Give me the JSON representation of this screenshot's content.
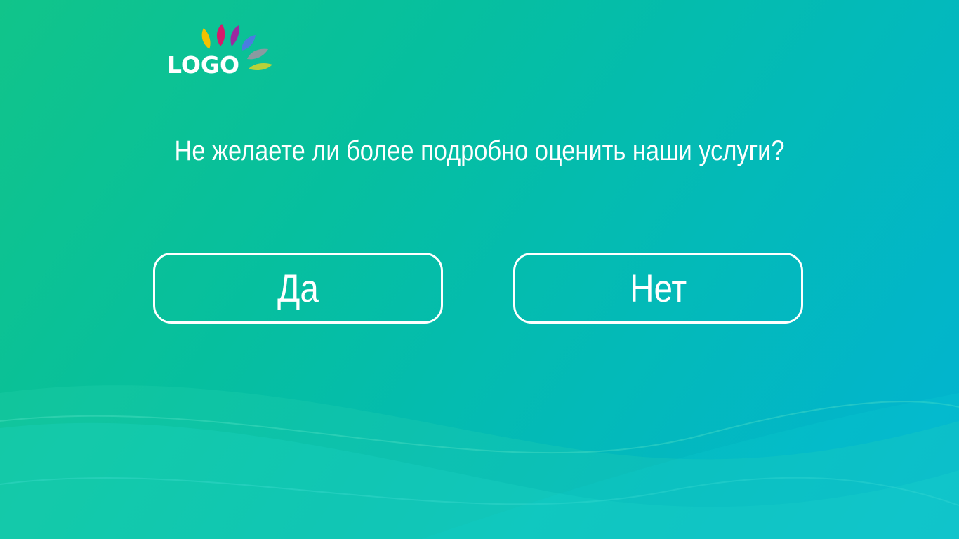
{
  "logo": {
    "text": "LOGO",
    "petal_colors": [
      "#f2c200",
      "#d51a6b",
      "#9b2aa0",
      "#4a7de0",
      "#8a9aa0",
      "#b7d13a"
    ]
  },
  "question": {
    "text": "Не желаете ли более подробно оценить наши услуги?"
  },
  "buttons": {
    "yes_label": "Да",
    "no_label": "Нет"
  },
  "colors": {
    "background_start": "#11c48a",
    "background_end": "#02b3d3",
    "text": "#ffffff"
  }
}
